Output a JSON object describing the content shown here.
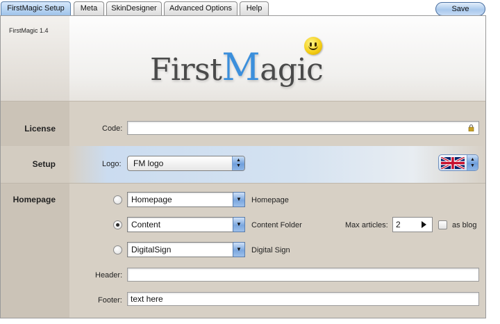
{
  "tabs": [
    {
      "label": "FirstMagic Setup",
      "active": true
    },
    {
      "label": "Meta",
      "active": false
    },
    {
      "label": "SkinDesigner",
      "active": false
    },
    {
      "label": "Advanced Options",
      "active": false
    },
    {
      "label": "Help",
      "active": false
    }
  ],
  "toolbar": {
    "save_label": "Save"
  },
  "app": {
    "version": "FirstMagic 1.4",
    "logo_text_1": "First",
    "logo_text_2": "M",
    "logo_text_3": "agic"
  },
  "license": {
    "section_label": "License",
    "code_label": "Code:",
    "code_value": ""
  },
  "setup": {
    "section_label": "Setup",
    "logo_label": "Logo:",
    "logo_value": "FM logo",
    "language_icon": "uk-flag-icon"
  },
  "homepage": {
    "section_label": "Homepage",
    "options": [
      {
        "value": "Homepage",
        "description": "Homepage",
        "selected": false
      },
      {
        "value": "Content",
        "description": "Content Folder",
        "selected": true
      },
      {
        "value": "DigitalSign",
        "description": "Digital Sign",
        "selected": false
      }
    ],
    "max_articles_label": "Max articles:",
    "max_articles_value": "2",
    "as_blog_label": "as blog",
    "as_blog_checked": false,
    "header_label": "Header:",
    "header_value": "",
    "footer_label": "Footer:",
    "footer_value": "text here"
  },
  "colors": {
    "accent": "#3b8fdc",
    "tab_active": "#9fc3ea",
    "panel": "#d7d0c5"
  }
}
